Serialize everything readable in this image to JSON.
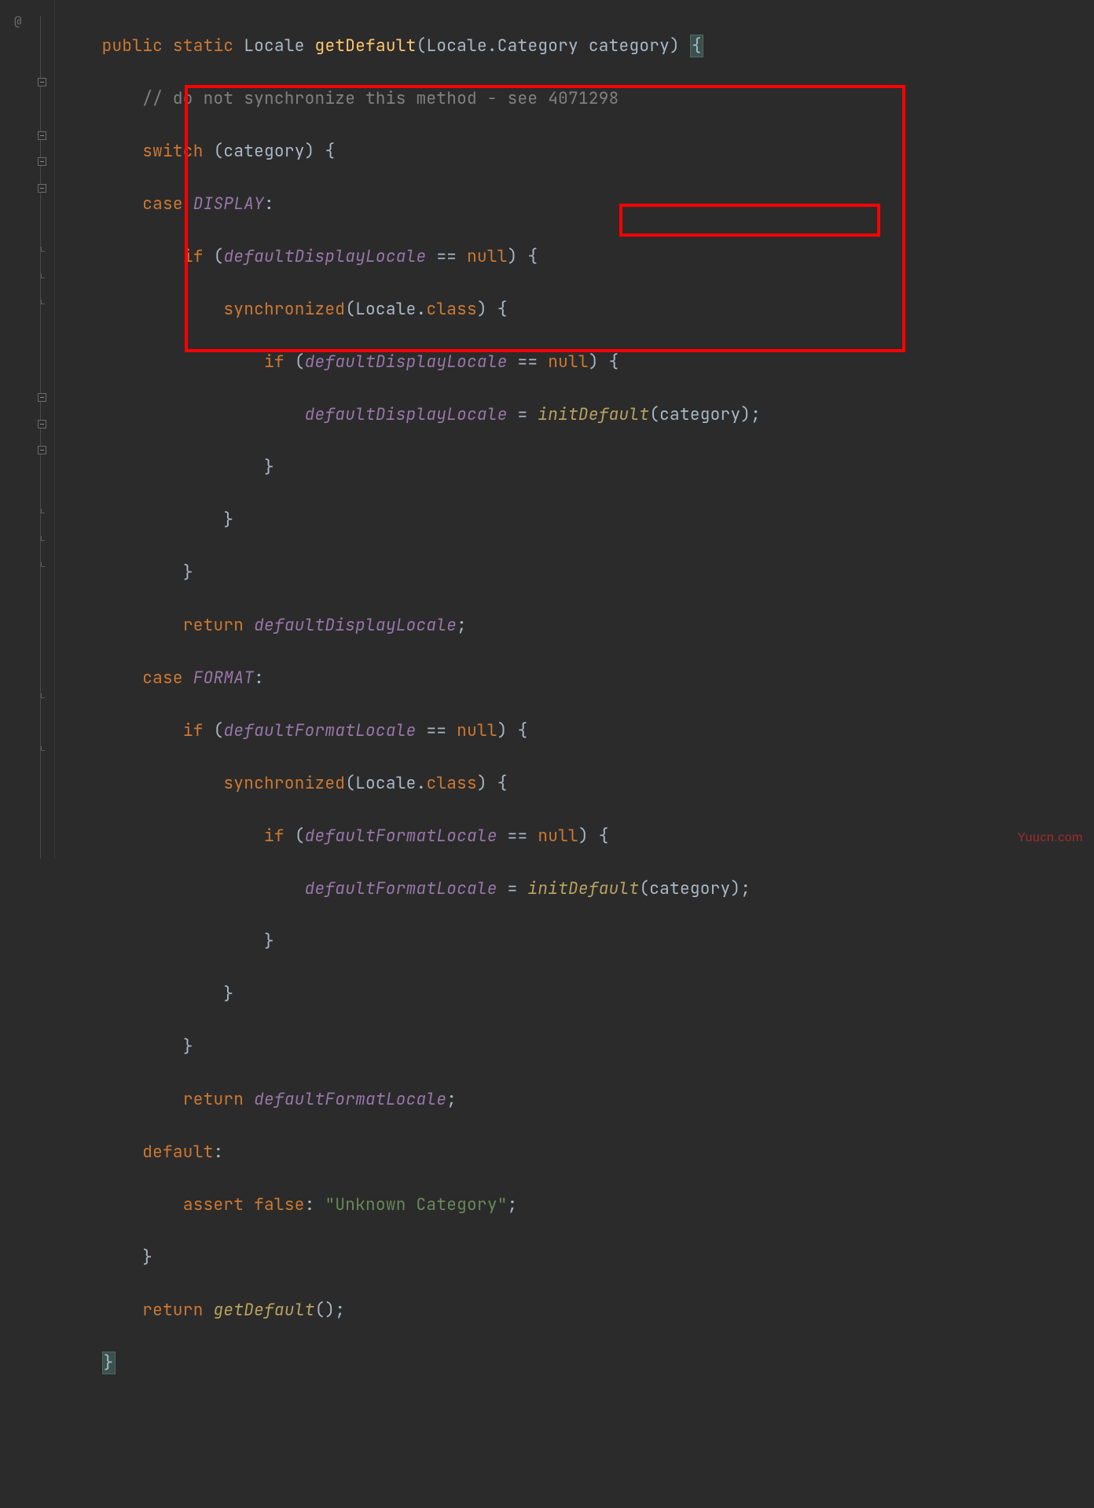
{
  "code": {
    "l1": {
      "kw1": "public",
      "kw2": "static",
      "type": "Locale",
      "method": "getDefault",
      "paren_open": "(",
      "param_type": "Locale.Category",
      "param_name": "category",
      "paren_close": ")",
      "brace": "{"
    },
    "l2": {
      "comment": "// do not synchronize this method - see 4071298"
    },
    "l3": {
      "kw": "switch",
      "paren_open": "(",
      "var": "category",
      "paren_close": ")",
      "brace": "{"
    },
    "l4": {
      "kw": "case",
      "const": "DISPLAY",
      "colon": ":"
    },
    "l5": {
      "kw": "if",
      "paren_open": "(",
      "field": "defaultDisplayLocale",
      "op": "==",
      "null": "null",
      "paren_close": ")",
      "brace": "{"
    },
    "l6": {
      "kw": "synchronized",
      "paren_open": "(",
      "type": "Locale",
      "dot": ".",
      "class": "class",
      "paren_close": ")",
      "brace": "{"
    },
    "l7": {
      "kw": "if",
      "paren_open": "(",
      "field": "defaultDisplayLocale",
      "op": "==",
      "null": "null",
      "paren_close": ")",
      "brace": "{"
    },
    "l8": {
      "field": "defaultDisplayLocale",
      "op": "=",
      "method": "initDefault",
      "paren_open": "(",
      "arg": "category",
      "paren_close": ")",
      "semi": ";"
    },
    "l9": {
      "brace": "}"
    },
    "l10": {
      "brace": "}"
    },
    "l11": {
      "brace": "}"
    },
    "l12": {
      "kw": "return",
      "field": "defaultDisplayLocale",
      "semi": ";"
    },
    "l13": {
      "kw": "case",
      "const": "FORMAT",
      "colon": ":"
    },
    "l14": {
      "kw": "if",
      "paren_open": "(",
      "field": "defaultFormatLocale",
      "op": "==",
      "null": "null",
      "paren_close": ")",
      "brace": "{"
    },
    "l15": {
      "kw": "synchronized",
      "paren_open": "(",
      "type": "Locale",
      "dot": ".",
      "class": "class",
      "paren_close": ")",
      "brace": "{"
    },
    "l16": {
      "kw": "if",
      "paren_open": "(",
      "field": "defaultFormatLocale",
      "op": "==",
      "null": "null",
      "paren_close": ")",
      "brace": "{"
    },
    "l17": {
      "field": "defaultFormatLocale",
      "op": "=",
      "method": "initDefault",
      "paren_open": "(",
      "arg": "category",
      "paren_close": ")",
      "semi": ";"
    },
    "l18": {
      "brace": "}"
    },
    "l19": {
      "brace": "}"
    },
    "l20": {
      "brace": "}"
    },
    "l21": {
      "kw": "return",
      "field": "defaultFormatLocale",
      "semi": ";"
    },
    "l22": {
      "kw": "default",
      "colon": ":"
    },
    "l23": {
      "kw": "assert",
      "false": "false",
      "colon": ":",
      "str": "\"Unknown Category\"",
      "semi": ";"
    },
    "l24": {
      "brace": "}"
    },
    "l25": {
      "kw": "return",
      "method": "getDefault",
      "paren_open": "(",
      "paren_close": ")",
      "semi": ";"
    },
    "l26": {
      "brace": "}"
    }
  },
  "watermark": "Yuucn.com"
}
